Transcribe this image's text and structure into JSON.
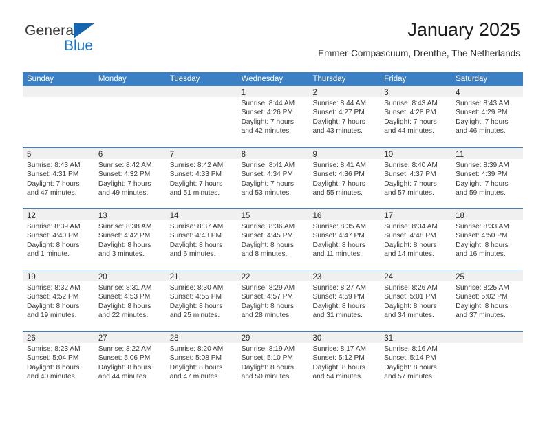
{
  "brand": {
    "name_top": "General",
    "name_bottom": "Blue",
    "color_text": "#3b3b3b",
    "color_blue": "#1871c4"
  },
  "header": {
    "title": "January 2025",
    "subtitle": "Emmer-Compascuum, Drenthe, The Netherlands"
  },
  "theme": {
    "header_blue": "#3b7fc4",
    "band_gray": "#f0f0f0"
  },
  "weekdays": [
    "Sunday",
    "Monday",
    "Tuesday",
    "Wednesday",
    "Thursday",
    "Friday",
    "Saturday"
  ],
  "labels": {
    "sunrise": "Sunrise:",
    "sunset": "Sunset:",
    "daylight": "Daylight:"
  },
  "weeks": [
    [
      {
        "day": "",
        "sunrise": "",
        "sunset": "",
        "daylight1": "",
        "daylight2": ""
      },
      {
        "day": "",
        "sunrise": "",
        "sunset": "",
        "daylight1": "",
        "daylight2": ""
      },
      {
        "day": "",
        "sunrise": "",
        "sunset": "",
        "daylight1": "",
        "daylight2": ""
      },
      {
        "day": "1",
        "sunrise": "Sunrise: 8:44 AM",
        "sunset": "Sunset: 4:26 PM",
        "daylight1": "Daylight: 7 hours",
        "daylight2": "and 42 minutes."
      },
      {
        "day": "2",
        "sunrise": "Sunrise: 8:44 AM",
        "sunset": "Sunset: 4:27 PM",
        "daylight1": "Daylight: 7 hours",
        "daylight2": "and 43 minutes."
      },
      {
        "day": "3",
        "sunrise": "Sunrise: 8:43 AM",
        "sunset": "Sunset: 4:28 PM",
        "daylight1": "Daylight: 7 hours",
        "daylight2": "and 44 minutes."
      },
      {
        "day": "4",
        "sunrise": "Sunrise: 8:43 AM",
        "sunset": "Sunset: 4:29 PM",
        "daylight1": "Daylight: 7 hours",
        "daylight2": "and 46 minutes."
      }
    ],
    [
      {
        "day": "5",
        "sunrise": "Sunrise: 8:43 AM",
        "sunset": "Sunset: 4:31 PM",
        "daylight1": "Daylight: 7 hours",
        "daylight2": "and 47 minutes."
      },
      {
        "day": "6",
        "sunrise": "Sunrise: 8:42 AM",
        "sunset": "Sunset: 4:32 PM",
        "daylight1": "Daylight: 7 hours",
        "daylight2": "and 49 minutes."
      },
      {
        "day": "7",
        "sunrise": "Sunrise: 8:42 AM",
        "sunset": "Sunset: 4:33 PM",
        "daylight1": "Daylight: 7 hours",
        "daylight2": "and 51 minutes."
      },
      {
        "day": "8",
        "sunrise": "Sunrise: 8:41 AM",
        "sunset": "Sunset: 4:34 PM",
        "daylight1": "Daylight: 7 hours",
        "daylight2": "and 53 minutes."
      },
      {
        "day": "9",
        "sunrise": "Sunrise: 8:41 AM",
        "sunset": "Sunset: 4:36 PM",
        "daylight1": "Daylight: 7 hours",
        "daylight2": "and 55 minutes."
      },
      {
        "day": "10",
        "sunrise": "Sunrise: 8:40 AM",
        "sunset": "Sunset: 4:37 PM",
        "daylight1": "Daylight: 7 hours",
        "daylight2": "and 57 minutes."
      },
      {
        "day": "11",
        "sunrise": "Sunrise: 8:39 AM",
        "sunset": "Sunset: 4:39 PM",
        "daylight1": "Daylight: 7 hours",
        "daylight2": "and 59 minutes."
      }
    ],
    [
      {
        "day": "12",
        "sunrise": "Sunrise: 8:39 AM",
        "sunset": "Sunset: 4:40 PM",
        "daylight1": "Daylight: 8 hours",
        "daylight2": "and 1 minute."
      },
      {
        "day": "13",
        "sunrise": "Sunrise: 8:38 AM",
        "sunset": "Sunset: 4:42 PM",
        "daylight1": "Daylight: 8 hours",
        "daylight2": "and 3 minutes."
      },
      {
        "day": "14",
        "sunrise": "Sunrise: 8:37 AM",
        "sunset": "Sunset: 4:43 PM",
        "daylight1": "Daylight: 8 hours",
        "daylight2": "and 6 minutes."
      },
      {
        "day": "15",
        "sunrise": "Sunrise: 8:36 AM",
        "sunset": "Sunset: 4:45 PM",
        "daylight1": "Daylight: 8 hours",
        "daylight2": "and 8 minutes."
      },
      {
        "day": "16",
        "sunrise": "Sunrise: 8:35 AM",
        "sunset": "Sunset: 4:47 PM",
        "daylight1": "Daylight: 8 hours",
        "daylight2": "and 11 minutes."
      },
      {
        "day": "17",
        "sunrise": "Sunrise: 8:34 AM",
        "sunset": "Sunset: 4:48 PM",
        "daylight1": "Daylight: 8 hours",
        "daylight2": "and 14 minutes."
      },
      {
        "day": "18",
        "sunrise": "Sunrise: 8:33 AM",
        "sunset": "Sunset: 4:50 PM",
        "daylight1": "Daylight: 8 hours",
        "daylight2": "and 16 minutes."
      }
    ],
    [
      {
        "day": "19",
        "sunrise": "Sunrise: 8:32 AM",
        "sunset": "Sunset: 4:52 PM",
        "daylight1": "Daylight: 8 hours",
        "daylight2": "and 19 minutes."
      },
      {
        "day": "20",
        "sunrise": "Sunrise: 8:31 AM",
        "sunset": "Sunset: 4:53 PM",
        "daylight1": "Daylight: 8 hours",
        "daylight2": "and 22 minutes."
      },
      {
        "day": "21",
        "sunrise": "Sunrise: 8:30 AM",
        "sunset": "Sunset: 4:55 PM",
        "daylight1": "Daylight: 8 hours",
        "daylight2": "and 25 minutes."
      },
      {
        "day": "22",
        "sunrise": "Sunrise: 8:29 AM",
        "sunset": "Sunset: 4:57 PM",
        "daylight1": "Daylight: 8 hours",
        "daylight2": "and 28 minutes."
      },
      {
        "day": "23",
        "sunrise": "Sunrise: 8:27 AM",
        "sunset": "Sunset: 4:59 PM",
        "daylight1": "Daylight: 8 hours",
        "daylight2": "and 31 minutes."
      },
      {
        "day": "24",
        "sunrise": "Sunrise: 8:26 AM",
        "sunset": "Sunset: 5:01 PM",
        "daylight1": "Daylight: 8 hours",
        "daylight2": "and 34 minutes."
      },
      {
        "day": "25",
        "sunrise": "Sunrise: 8:25 AM",
        "sunset": "Sunset: 5:02 PM",
        "daylight1": "Daylight: 8 hours",
        "daylight2": "and 37 minutes."
      }
    ],
    [
      {
        "day": "26",
        "sunrise": "Sunrise: 8:23 AM",
        "sunset": "Sunset: 5:04 PM",
        "daylight1": "Daylight: 8 hours",
        "daylight2": "and 40 minutes."
      },
      {
        "day": "27",
        "sunrise": "Sunrise: 8:22 AM",
        "sunset": "Sunset: 5:06 PM",
        "daylight1": "Daylight: 8 hours",
        "daylight2": "and 44 minutes."
      },
      {
        "day": "28",
        "sunrise": "Sunrise: 8:20 AM",
        "sunset": "Sunset: 5:08 PM",
        "daylight1": "Daylight: 8 hours",
        "daylight2": "and 47 minutes."
      },
      {
        "day": "29",
        "sunrise": "Sunrise: 8:19 AM",
        "sunset": "Sunset: 5:10 PM",
        "daylight1": "Daylight: 8 hours",
        "daylight2": "and 50 minutes."
      },
      {
        "day": "30",
        "sunrise": "Sunrise: 8:17 AM",
        "sunset": "Sunset: 5:12 PM",
        "daylight1": "Daylight: 8 hours",
        "daylight2": "and 54 minutes."
      },
      {
        "day": "31",
        "sunrise": "Sunrise: 8:16 AM",
        "sunset": "Sunset: 5:14 PM",
        "daylight1": "Daylight: 8 hours",
        "daylight2": "and 57 minutes."
      },
      {
        "day": "",
        "sunrise": "",
        "sunset": "",
        "daylight1": "",
        "daylight2": ""
      }
    ]
  ]
}
